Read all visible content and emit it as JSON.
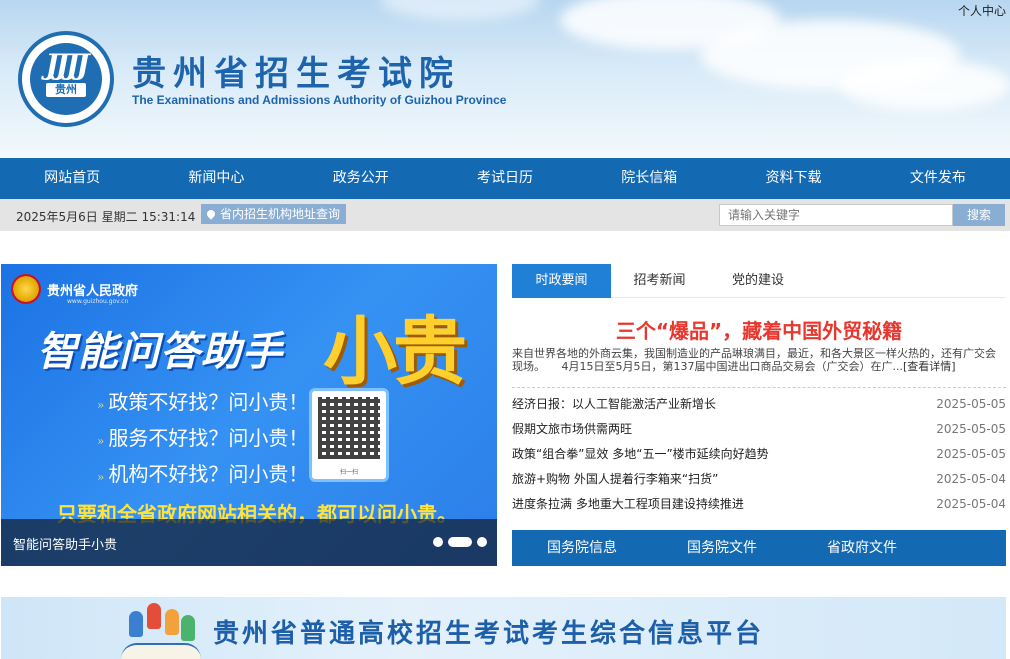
{
  "header": {
    "user_center": "个人中心",
    "logo_text": "贵州",
    "site_title": "贵州省招生考试院",
    "site_subtitle": "The Examinations and Admissions Authority of Guizhou Province"
  },
  "nav": {
    "items": [
      "网站首页",
      "新闻中心",
      "政务公开",
      "考试日历",
      "院长信箱",
      "资料下载",
      "文件发布"
    ]
  },
  "infobar": {
    "datetime": "2025年5月6日 星期二 15:31:14",
    "locate_label": "省内招生机构地址查询",
    "search_placeholder": "请输入关键字",
    "search_button": "搜索"
  },
  "banner": {
    "gov_name": "贵州省人民政府",
    "gov_url": "www.guizhou.gov.cn",
    "title": "智能问答助手",
    "title_highlight": "小贵",
    "lines": [
      "政策不好找？问小贵！",
      "服务不好找？问小贵！",
      "机构不好找？问小贵！"
    ],
    "qr_label": "扫一扫",
    "slogan": "只要和全省政府网站相关的，都可以问小贵。",
    "caption": "智能问答助手小贵",
    "slide_count": 3,
    "active_slide": 1
  },
  "news": {
    "tabs": [
      "时政要闻",
      "招考新闻",
      "党的建设"
    ],
    "active_tab": 0,
    "headline": "三个“爆品”，藏着中国外贸秘籍",
    "summary": "来自世界各地的外商云集，我国制造业的产品琳琅满目，最近，和各大景区一样火热的，还有广交会现场。　　4月15日至5月5日，第137届中国进出口商品交易会（广交会）在广...",
    "summary_more": "[查看详情]",
    "items": [
      {
        "title": "经济日报：以人工智能激活产业新增长",
        "date": "2025-05-05"
      },
      {
        "title": "假期文旅市场供需两旺",
        "date": "2025-05-05"
      },
      {
        "title": "政策“组合拳”显效 多地“五一”楼市延续向好趋势",
        "date": "2025-05-05"
      },
      {
        "title": "旅游+购物 外国人提着行李箱来“扫货”",
        "date": "2025-05-04"
      },
      {
        "title": "进度条拉满 多地重大工程项目建设持续推进",
        "date": "2025-05-04"
      }
    ],
    "quick_links": [
      "国务院信息",
      "国务院文件",
      "省政府文件"
    ]
  },
  "platform": {
    "title": "贵州省普通高校招生考试考生综合信息平台"
  },
  "colors": {
    "nav_blue": "#1469b3",
    "tab_active": "#1f80d6",
    "headline_red": "#e8372f",
    "title_blue": "#1d64ad"
  }
}
